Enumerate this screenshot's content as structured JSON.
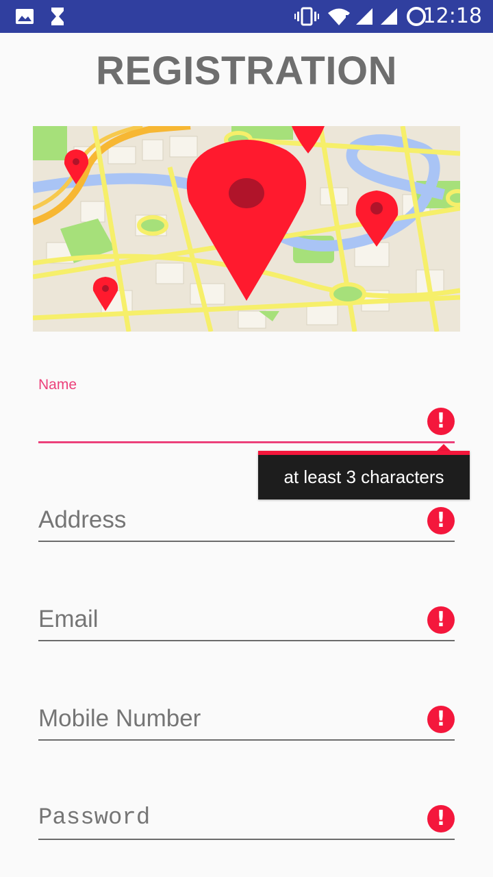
{
  "status_bar": {
    "time": "12:18",
    "icons": [
      "image-icon",
      "hourglass-icon",
      "vibrate-icon",
      "wifi-icon",
      "signal-icon",
      "signal-icon",
      "sync-icon"
    ]
  },
  "page": {
    "title": "REGISTRATION"
  },
  "banner": {
    "icon": "map-with-pins-illustration",
    "colors": {
      "pin": "#ff1a2e",
      "road": "#f6ef6a",
      "water": "#a9c4f5",
      "park": "#a6e07a",
      "land": "#ece6d8"
    }
  },
  "form": {
    "name": {
      "label": "Name",
      "value": "",
      "placeholder": "",
      "error": "at least 3 characters"
    },
    "address": {
      "placeholder": "Address",
      "value": ""
    },
    "email": {
      "placeholder": "Email",
      "value": ""
    },
    "mobile": {
      "placeholder": "Mobile Number",
      "value": ""
    },
    "password": {
      "placeholder": "Password",
      "value": ""
    }
  },
  "colors": {
    "status_bar": "#303f9f",
    "accent": "#ec407a",
    "error": "#f4173c",
    "title": "#6e6e6e"
  }
}
